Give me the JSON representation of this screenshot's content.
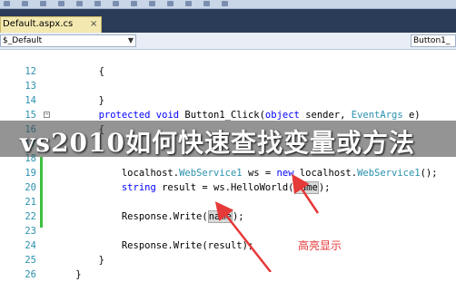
{
  "toolbar": {
    "icons": [
      "undo-icon",
      "redo-icon",
      "save-icon",
      "cut-icon",
      "copy-icon",
      "paste-icon",
      "find-icon",
      "debug-icon",
      "build-icon",
      "comment-icon",
      "indent-icon",
      "outdent-icon",
      "bookmark-icon"
    ]
  },
  "tab": {
    "label": "Default.aspx.cs",
    "close": "×"
  },
  "nav": {
    "left": "$_Default",
    "right": "Button1_"
  },
  "editor": {
    "lines": [
      {
        "num": "",
        "tokens": []
      },
      {
        "num": "12",
        "tokens": [
          {
            "t": "        {",
            "c": "pl"
          }
        ]
      },
      {
        "num": "13",
        "tokens": []
      },
      {
        "num": "14",
        "tokens": [
          {
            "t": "        }",
            "c": "pl"
          }
        ]
      },
      {
        "num": "15",
        "tokens": [
          {
            "t": "        protected ",
            "c": "kw"
          },
          {
            "t": "void ",
            "c": "kw"
          },
          {
            "t": "Button1_Click(",
            "c": "pl"
          },
          {
            "t": "object ",
            "c": "kw"
          },
          {
            "t": "sender, ",
            "c": "pl"
          },
          {
            "t": "EventArgs ",
            "c": "ty"
          },
          {
            "t": "e)",
            "c": "pl"
          }
        ]
      },
      {
        "num": "16",
        "tokens": [
          {
            "t": "        {",
            "c": "pl"
          }
        ]
      },
      {
        "num": "17",
        "tokens": []
      },
      {
        "num": "18",
        "tokens": []
      },
      {
        "num": "19",
        "tokens": [
          {
            "t": "            localhost.",
            "c": "pl"
          },
          {
            "t": "WebService1 ",
            "c": "ty"
          },
          {
            "t": "ws = ",
            "c": "pl"
          },
          {
            "t": "new ",
            "c": "kw"
          },
          {
            "t": "localhost.",
            "c": "pl"
          },
          {
            "t": "WebService1",
            "c": "ty"
          },
          {
            "t": "();",
            "c": "pl"
          }
        ]
      },
      {
        "num": "20",
        "tokens": [
          {
            "t": "            string ",
            "c": "kw"
          },
          {
            "t": "result = ws.HelloWorld(",
            "c": "pl"
          },
          {
            "t": "name",
            "c": "hl"
          },
          {
            "t": ");",
            "c": "pl"
          }
        ]
      },
      {
        "num": "21",
        "tokens": []
      },
      {
        "num": "22",
        "tokens": [
          {
            "t": "            Response.Write(",
            "c": "pl"
          },
          {
            "t": "name",
            "c": "hl"
          },
          {
            "t": ");",
            "c": "pl"
          }
        ]
      },
      {
        "num": "23",
        "tokens": []
      },
      {
        "num": "24",
        "tokens": [
          {
            "t": "            Response.Write(result);",
            "c": "pl"
          }
        ]
      },
      {
        "num": "25",
        "tokens": [
          {
            "t": "        }",
            "c": "pl"
          }
        ]
      },
      {
        "num": "26",
        "tokens": [
          {
            "t": "    }",
            "c": "pl"
          }
        ]
      }
    ]
  },
  "overlay": {
    "title": "vs2010如何快速查找变量或方法"
  },
  "annotation": {
    "label": "高亮显示",
    "color": "#e63939"
  }
}
